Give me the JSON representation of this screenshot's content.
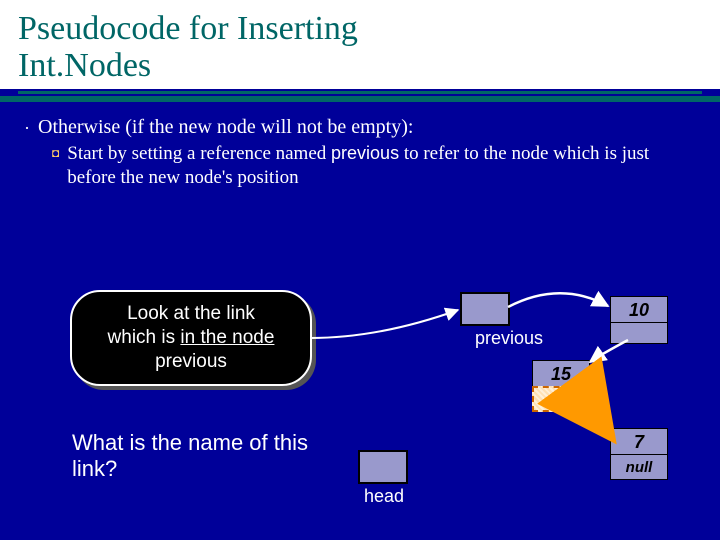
{
  "title_line1": "Pseudocode for Inserting",
  "title_line2": "Int.Nodes",
  "bullet": {
    "sym": "·",
    "text": "Otherwise (if the new node will not be empty):"
  },
  "subbullet": {
    "sym": "◘",
    "before": "Start by setting a reference named ",
    "code": "previous",
    "after": " to refer to the node which is just before the new node's position"
  },
  "hint": {
    "l1": "Look at the link",
    "l2a": "which is ",
    "l2b": "in the node",
    "l3": "previous"
  },
  "question": "What is the name of this link?",
  "labels": {
    "previous": "previous",
    "head": "head"
  },
  "values": {
    "n1": "10",
    "n2": "15",
    "n3": "7",
    "null": "null"
  },
  "chart_data": {
    "type": "diagram",
    "subject": "singly linked list insertion",
    "pointers": [
      {
        "name": "head",
        "points_to": "node_10"
      },
      {
        "name": "previous",
        "points_to": "node_10"
      }
    ],
    "nodes": [
      {
        "id": "node_10",
        "value": 10,
        "next": "node_15"
      },
      {
        "id": "node_15",
        "value": 15,
        "next": "node_7"
      },
      {
        "id": "node_7",
        "value": 7,
        "next": null
      }
    ],
    "insertion_target": {
      "after": "node_15",
      "highlight": "link field of previous"
    }
  }
}
